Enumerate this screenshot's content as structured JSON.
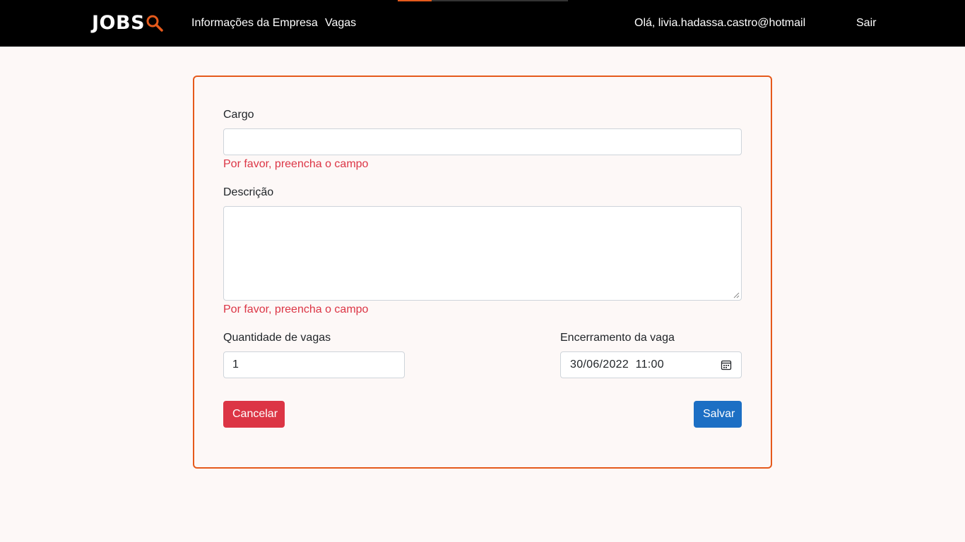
{
  "header": {
    "logo_text": "JOBS",
    "logo_icon": "magnifier-icon",
    "nav": {
      "empresa": "Informações da Empresa",
      "vagas": "Vagas"
    },
    "greeting": "Olá, livia.hadassa.castro@hotmail",
    "logout": "Sair",
    "loading_progress": 0.2
  },
  "form": {
    "cargo": {
      "label": "Cargo",
      "value": "",
      "error": "Por favor, preencha o campo"
    },
    "descricao": {
      "label": "Descrição",
      "value": "",
      "error": "Por favor, preencha o campo"
    },
    "quantidade": {
      "label": "Quantidade de vagas",
      "value": "1"
    },
    "encerramento": {
      "label": "Encerramento da vaga",
      "value": "30/06/2022  11:00",
      "icon": "calendar-icon"
    },
    "cancel_label": "Cancelar",
    "save_label": "Salvar"
  },
  "colors": {
    "accent": "#e55a1c",
    "error": "#dc3545",
    "primary": "#1c6fc4",
    "background": "#fdf8f7",
    "navbar": "#000000"
  }
}
